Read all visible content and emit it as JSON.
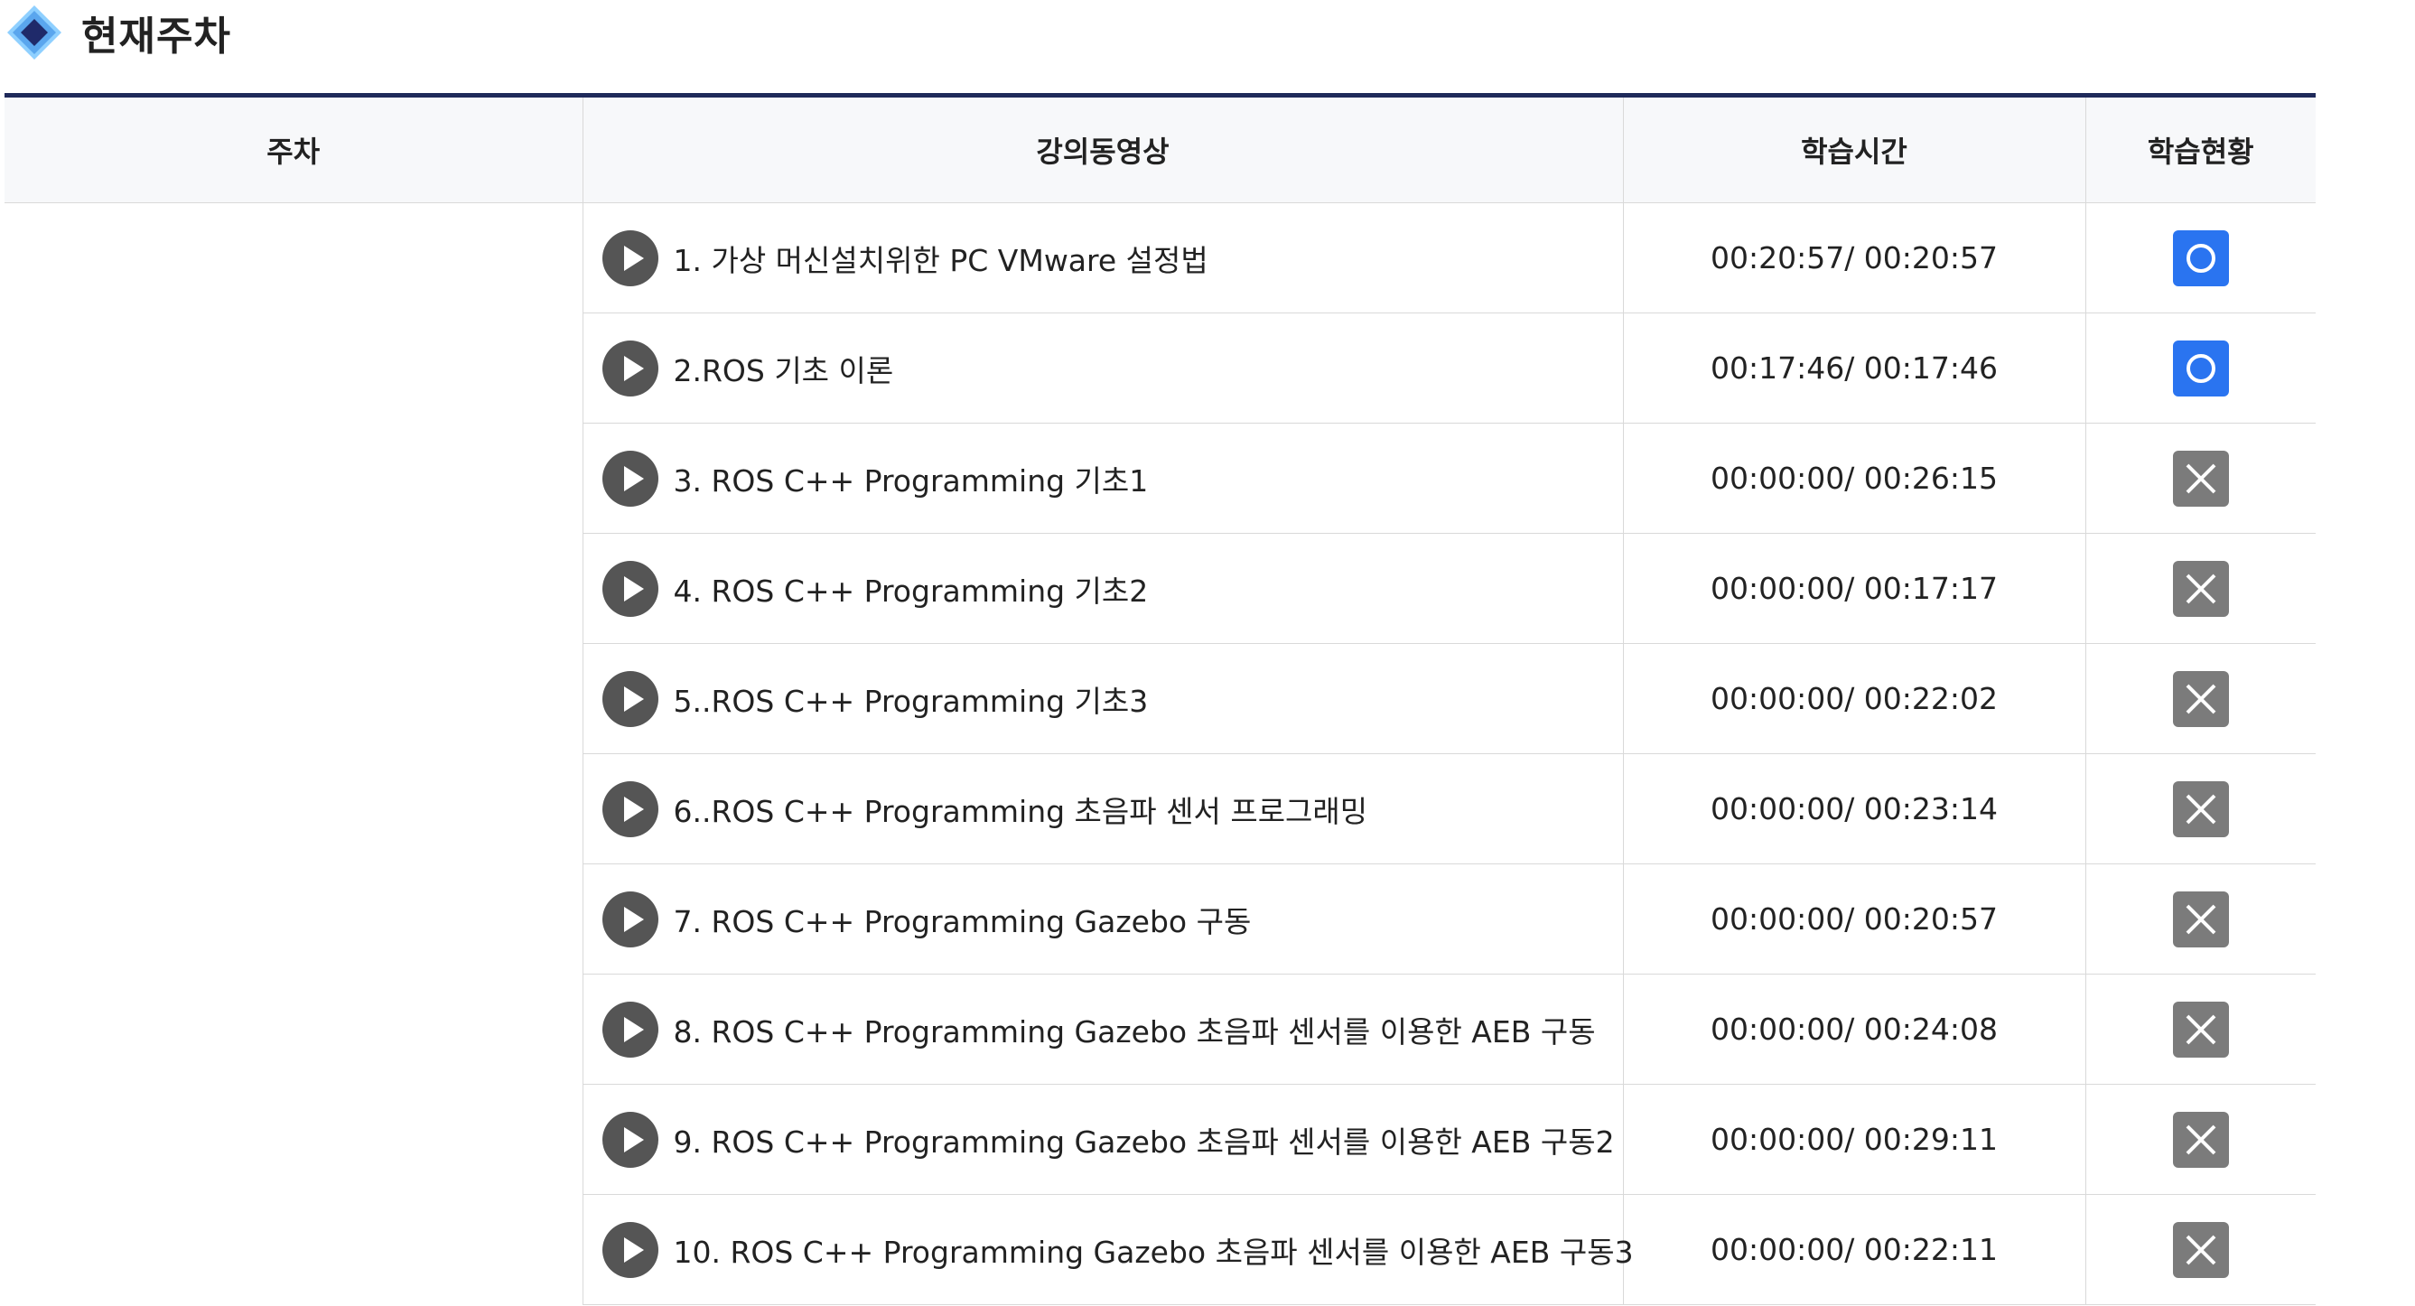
{
  "section": {
    "title": "현재주차",
    "icon": "diamond-icon"
  },
  "table": {
    "headers": {
      "week": "주차",
      "video": "강의동영상",
      "time": "학습시간",
      "status": "학습현황"
    },
    "rows": [
      {
        "title": "1. 가상 머신설치위한 PC VMware 설정법",
        "time": "00:20:57/ 00:20:57",
        "status": "complete"
      },
      {
        "title": "2.ROS 기초 이론",
        "time": "00:17:46/ 00:17:46",
        "status": "complete"
      },
      {
        "title": "3. ROS C++ Programming 기초1",
        "time": "00:00:00/ 00:26:15",
        "status": "incomplete"
      },
      {
        "title": "4. ROS C++ Programming 기초2",
        "time": "00:00:00/ 00:17:17",
        "status": "incomplete"
      },
      {
        "title": "5..ROS C++ Programming 기초3",
        "time": "00:00:00/ 00:22:02",
        "status": "incomplete"
      },
      {
        "title": "6..ROS C++ Programming 초음파 센서 프로그래밍",
        "time": "00:00:00/ 00:23:14",
        "status": "incomplete"
      },
      {
        "title": "7. ROS C++ Programming Gazebo 구동",
        "time": "00:00:00/ 00:20:57",
        "status": "incomplete"
      },
      {
        "title": "8. ROS C++ Programming Gazebo 초음파 센서를 이용한 AEB 구동",
        "time": "00:00:00/ 00:24:08",
        "status": "incomplete"
      },
      {
        "title": "9. ROS C++ Programming Gazebo 초음파 센서를 이용한 AEB 구동2",
        "time": "00:00:00/ 00:29:11",
        "status": "incomplete"
      },
      {
        "title": "10. ROS C++ Programming Gazebo 초음파 센서를 이용한 AEB 구동3",
        "time": "00:00:00/ 00:22:11",
        "status": "incomplete"
      }
    ]
  },
  "colors": {
    "accent_navy": "#1f2a5a",
    "complete_blue": "#2a74f0",
    "incomplete_gray": "#7b7b7b",
    "play_icon": "#555555"
  },
  "icons": {
    "play": "play-circle-icon",
    "complete": "circle-o-icon",
    "incomplete": "x-icon"
  }
}
